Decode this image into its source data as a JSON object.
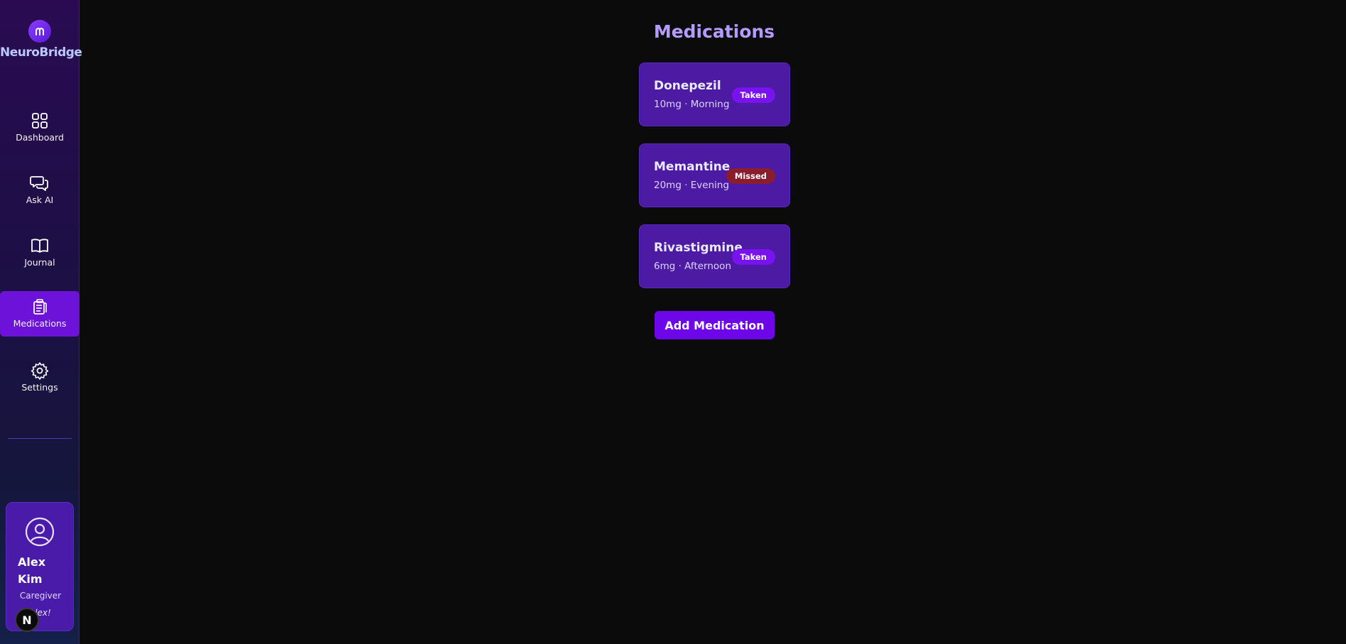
{
  "brand": {
    "name": "NeuroBridge",
    "logo_icon": "brain-logo-icon"
  },
  "sidebar": {
    "items": [
      {
        "label": "Dashboard",
        "icon": "grid-icon",
        "active": false
      },
      {
        "label": "Ask AI",
        "icon": "chat-bubbles-icon",
        "active": false
      },
      {
        "label": "Journal",
        "icon": "open-book-icon",
        "active": false
      },
      {
        "label": "Medications",
        "icon": "clipboard-icon",
        "active": true
      },
      {
        "label": "Settings",
        "icon": "gear-icon",
        "active": false
      }
    ]
  },
  "profile": {
    "name": "Alex Kim",
    "role": "Caregiver",
    "greeting": "Alex!",
    "badge": "N"
  },
  "main": {
    "title": "Medications",
    "medications": [
      {
        "name": "Donepezil",
        "detail": "10mg · Morning",
        "status": "Taken"
      },
      {
        "name": "Memantine",
        "detail": "20mg · Evening",
        "status": "Missed"
      },
      {
        "name": "Rivastigmine",
        "detail": "6mg · Afternoon",
        "status": "Taken"
      }
    ],
    "add_button_label": "Add Medication"
  },
  "colors": {
    "accent": "#6d06e8",
    "card": "#4c1aa3",
    "title": "#b59bff",
    "taken": "#7a12f0",
    "missed": "#8a1c2b",
    "background": "#0b0b0b"
  }
}
